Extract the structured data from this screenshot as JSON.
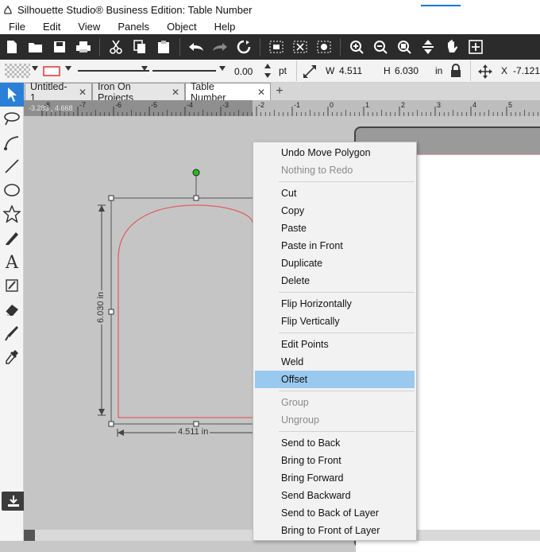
{
  "window": {
    "title": "Silhouette Studio® Business Edition: Table Number"
  },
  "menubar": {
    "items": [
      "File",
      "Edit",
      "View",
      "Panels",
      "Object",
      "Help"
    ]
  },
  "toolbar2": {
    "line_width": "0.00",
    "line_unit": "pt",
    "w_label": "W",
    "w_value": "4.511",
    "h_label": "H",
    "h_value": "6.030",
    "size_unit": "in",
    "x_label": "X",
    "x_value": "-7.121"
  },
  "tabs": [
    {
      "label": "Untitled-1",
      "close": "✕"
    },
    {
      "label": "Iron On Projects",
      "close": "✕"
    },
    {
      "label": "Table Number",
      "close": "✕"
    }
  ],
  "tab_add": "+",
  "ruler": {
    "readout": "-3.283 , 4.668",
    "labels": [
      "-8",
      "-7",
      "-6",
      "-5",
      "-4",
      "-3",
      "-2",
      "-1",
      "0",
      "1",
      "2",
      "3",
      "4",
      "5"
    ]
  },
  "shape": {
    "height_label": "6.030 in",
    "width_label": "4.511 in",
    "stroke_color": "#e06060",
    "rotate_handle_color": "#22bb22"
  },
  "context_menu": {
    "groups": [
      [
        {
          "label": "Undo Move Polygon",
          "enabled": true
        },
        {
          "label": "Nothing to Redo",
          "enabled": false
        }
      ],
      [
        {
          "label": "Cut",
          "enabled": true
        },
        {
          "label": "Copy",
          "enabled": true
        },
        {
          "label": "Paste",
          "enabled": true
        },
        {
          "label": "Paste in Front",
          "enabled": true
        },
        {
          "label": "Duplicate",
          "enabled": true
        },
        {
          "label": "Delete",
          "enabled": true
        }
      ],
      [
        {
          "label": "Flip Horizontally",
          "enabled": true
        },
        {
          "label": "Flip Vertically",
          "enabled": true
        }
      ],
      [
        {
          "label": "Edit Points",
          "enabled": true
        },
        {
          "label": "Weld",
          "enabled": true
        },
        {
          "label": "Offset",
          "enabled": true,
          "highlighted": true
        }
      ],
      [
        {
          "label": "Group",
          "enabled": false
        },
        {
          "label": "Ungroup",
          "enabled": false
        }
      ],
      [
        {
          "label": "Send to Back",
          "enabled": true
        },
        {
          "label": "Bring to Front",
          "enabled": true
        },
        {
          "label": "Bring Forward",
          "enabled": true
        },
        {
          "label": "Send Backward",
          "enabled": true
        },
        {
          "label": "Send to Back of Layer",
          "enabled": true
        },
        {
          "label": "Bring to Front of Layer",
          "enabled": true
        }
      ]
    ]
  },
  "colors": {
    "accent": "#2a7fd6",
    "highlight": "#99c9ef",
    "toolbar_dark": "#2b2b2b"
  }
}
